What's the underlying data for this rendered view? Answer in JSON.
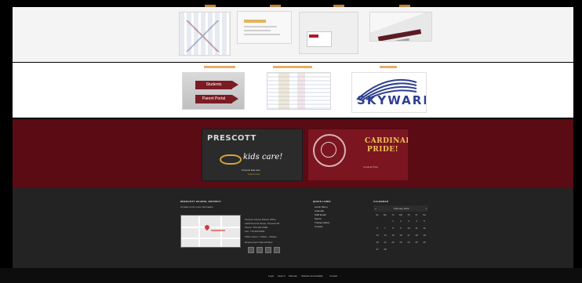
{
  "row2": {
    "skyward_logo": "SKYWARD",
    "arrow_labels": [
      "Students",
      "Parent Portal"
    ]
  },
  "banners": {
    "prescott": {
      "title": "PRESCOTT",
      "tagline": "kids care!",
      "small1": "Prescott kids care",
      "small2": "Learn more"
    },
    "cardinal": {
      "line1": "CARDINAL",
      "line2": "PRIDE!",
      "small": "Cardinal Pride"
    }
  },
  "footer": {
    "contact": {
      "heading": "PRESCOTT SCHOOL DISTRICT",
      "subtitle": "Contact us for more information",
      "address": [
        "Prescott School District Office",
        "1100 Prescott Street, Prescott WI",
        "Phone: 715-262-5489",
        "Fax: 715-262-5094",
        "Office Hours: 7:30am - 4:00pm",
        "Employment Opportunities"
      ]
    },
    "quick_links": {
      "heading": "QUICK LINKS",
      "items": [
        "Lunch Menu",
        "Calendar",
        "Staff Email",
        "Sports",
        "Transportation",
        "Contact"
      ]
    },
    "calendar": {
      "heading": "CALENDAR",
      "prev": "«",
      "month": "February 2022",
      "next": "»",
      "dow": [
        "Su",
        "Mo",
        "Tu",
        "We",
        "Th",
        "Fr",
        "Sa"
      ],
      "days": [
        "",
        "",
        "1",
        "2",
        "3",
        "4",
        "5",
        "6",
        "7",
        "8",
        "9",
        "10",
        "11",
        "12",
        "13",
        "14",
        "15",
        "16",
        "17",
        "18",
        "19",
        "20",
        "21",
        "22",
        "23",
        "24",
        "25",
        "26",
        "27",
        "28"
      ]
    }
  },
  "bottom_nav": [
    "Login",
    "Search",
    "Sitemap",
    "Website Accessibility",
    "Contact"
  ],
  "colors": {
    "maroon": "#5a0b14",
    "footer": "#232323",
    "accent": "#e6a14a",
    "skyward_blue": "#2e3f8f"
  }
}
